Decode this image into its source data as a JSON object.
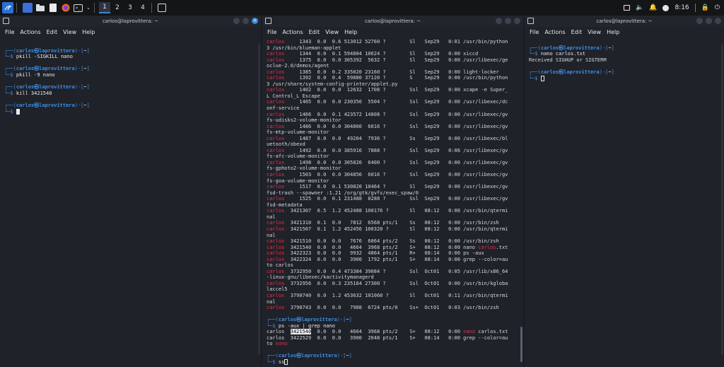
{
  "topbar": {
    "workspaces": [
      "1",
      "2",
      "3",
      "4"
    ],
    "clock": "8:16",
    "icons": [
      "kali-menu-icon",
      "app-icon",
      "folder-icon",
      "text-editor-icon",
      "firefox-icon",
      "terminal-icon",
      "chevron-down-icon",
      "screenshot-icon"
    ],
    "tray": [
      "window-icon",
      "volume-icon",
      "bell-icon",
      "clock-icon",
      "lock-icon",
      "power-icon"
    ]
  },
  "menu": {
    "file": "File",
    "actions": "Actions",
    "edit": "Edit",
    "view": "View",
    "help": "Help"
  },
  "left": {
    "title": "carlos@laprovittera: ~",
    "blocks": [
      {
        "user": "carlos",
        "host": "laprovittera",
        "dir": "~",
        "cmd": "pkill -SIGKILL nano"
      },
      {
        "user": "carlos",
        "host": "laprovittera",
        "dir": "~",
        "cmd": "pkill -9 nano"
      },
      {
        "user": "carlos",
        "host": "laprovittera",
        "dir": "~",
        "cmd": "kill 3421540"
      },
      {
        "user": "carlos",
        "host": "laprovittera",
        "dir": "~",
        "cmd": ""
      }
    ]
  },
  "middle": {
    "title": "carlos@laprovittera: ~",
    "ps_lines": [
      [
        "carlos",
        "     1343  0.0  0.6 513012 52760 ?        Sl   Sep29   0:01 /usr/bin/python"
      ],
      [
        "",
        "3 /usr/bin/blueman-applet"
      ],
      [
        "carlos",
        "     1344  0.0  0.1 594804 10624 ?        Sl   Sep29   0:00 xiccd"
      ],
      [
        "carlos",
        "     1375  0.0  0.0 305392  5632 ?        Sl   Sep29   0:00 /usr/libexec/ge"
      ],
      [
        "",
        "oclue-2.0/demos/agent"
      ],
      [
        "carlos",
        "     1385  0.0  0.2 335020 23160 ?        Sl   Sep29   0:00 light-locker"
      ],
      [
        "carlos",
        "     1392  0.0  0.4  59880 37120 ?        S    Sep29   0:00 /usr/bin/python"
      ],
      [
        "",
        "3 /usr/share/system-config-printer/applet.py"
      ],
      [
        "carlos",
        "     1402  0.0  0.0  12632  1708 ?        Ssl  Sep29   0:00 xcape -e Super_"
      ],
      [
        "",
        "L Control_L Escape"
      ],
      [
        "carlos",
        "     1405  0.0  0.0 230356  5504 ?        Ssl  Sep29   0:00 /usr/libexec/dc"
      ],
      [
        "",
        "onf-service"
      ],
      [
        "carlos",
        "     1466  0.0  0.1 423572 14808 ?        Ssl  Sep29   0:00 /usr/libexec/gv"
      ],
      [
        "",
        "fs-udisks2-volume-monitor"
      ],
      [
        "carlos",
        "     1486  0.0  0.0 304860  6016 ?        Ssl  Sep29   0:00 /usr/libexec/gv"
      ],
      [
        "",
        "fs-mtp-volume-monitor"
      ],
      [
        "carlos",
        "     1487  0.0  0.0  49204  7936 ?        Ss   Sep29   0:00 /usr/libexec/bl"
      ],
      [
        "",
        "uetooth/obexd"
      ],
      [
        "carlos",
        "     1492  0.0  0.0 385916  7888 ?        Ssl  Sep29   0:06 /usr/libexec/gv"
      ],
      [
        "",
        "fs-afc-volume-monitor"
      ],
      [
        "carlos",
        "     1498  0.0  0.0 305820  6400 ?        Ssl  Sep29   0:00 /usr/libexec/gv"
      ],
      [
        "",
        "fs-gphoto2-volume-monitor"
      ],
      [
        "carlos",
        "     1503  0.0  0.0 304856  6016 ?        Ssl  Sep29   0:00 /usr/libexec/gv"
      ],
      [
        "",
        "fs-goa-volume-monitor"
      ],
      [
        "carlos",
        "     1517  0.0  0.1 530820 10464 ?        Sl   Sep29   0:00 /usr/libexec/gv"
      ],
      [
        "",
        "fsd-trash --spawner :1.21 /org/gtk/gvfs/exec_spaw/0"
      ],
      [
        "carlos",
        "     1525  0.0  0.1 231488  8288 ?        Ssl  Sep29   0:00 /usr/libexec/gv"
      ],
      [
        "",
        "fsd-metadata"
      ],
      [
        "carlos",
        "  3421307  0.5  1.2 452488 100176 ?       Sl   08:12   0:00 /usr/bin/qtermi"
      ],
      [
        "",
        "nal"
      ],
      [
        "carlos",
        "  3421310  0.1  0.0   7812  6568 pts/1    Ss   08:12   0:00 /usr/bin/zsh"
      ],
      [
        "carlos",
        "  3421507  0.1  1.2 452456 100320 ?       Sl   08:12   0:00 /usr/bin/qtermi"
      ],
      [
        "",
        "nal"
      ],
      [
        "carlos",
        "  3421510  0.0  0.0   7676  6064 pts/2    Ss   08:12   0:00 /usr/bin/zsh"
      ],
      [
        "carlos",
        "  3421540  0.0  0.0   4664  3968 pts/2    S+   08:12   0:00 nano carlos.txt"
      ],
      [
        "carlos",
        "  3422323  0.0  0.0   9932  4864 pts/1    R+   08:14   0:00 ps -aux"
      ],
      [
        "carlos",
        "  3422324  0.0  0.0   3900  1792 pts/1    S+   08:14   0:00 grep --color=au"
      ],
      [
        "",
        "to carlos"
      ],
      [
        "carlos",
        "  3732950  0.0  0.4 473384 39084 ?        Ssl  Oct01   0:05 /usr/lib/x86_64"
      ],
      [
        "",
        "-linux-gnu/libexec/kactivitymanagerd"
      ],
      [
        "carlos",
        "  3732956  0.0  0.3 235164 27300 ?        Ssl  Oct01   0:00 /usr/bin/kgloba"
      ],
      [
        "",
        "laccel5"
      ],
      [
        "carlos",
        "  3790740  0.0  1.2 453632 101060 ?       Sl   Oct01   0:11 /usr/bin/qtermi"
      ],
      [
        "",
        "nal"
      ],
      [
        "carlos",
        "  3790743  0.0  0.0   7908  6724 pts/0    Ss+  Oct01   0:03 /usr/bin/zsh"
      ]
    ],
    "prompt1": {
      "user": "carlos",
      "host": "laprovittera",
      "dir": "~",
      "cmd": "ps -aux | grep nano"
    },
    "grep_lines": [
      {
        "user": "carlos",
        "pid": "3421540",
        "rest": "  0.0  0.0   4664  3968 pts/2    S+   08:12   0:00 ",
        "hl": "nano",
        "tail": " carlos.txt"
      },
      {
        "user": "carlos",
        "pid": "3422529",
        "rest": "  0.0  0.0   3900  2048 pts/1    S+   08:14   0:00 grep --color=au",
        "hl": "",
        "tail": ""
      }
    ],
    "grep_tail": "to ",
    "grep_tail_red": "nano",
    "prompt2": {
      "user": "carlos",
      "host": "laprovittera",
      "dir": "~",
      "cmd": "ss"
    }
  },
  "right": {
    "title": "carlos@laprovittera: ~",
    "prompt1": {
      "user": "carlos",
      "host": "laprovittera",
      "dir": "~",
      "cmd": "nano carlos.txt"
    },
    "output": "Received SIGHUP or SIGTERM",
    "prompt2": {
      "user": "carlos",
      "host": "laprovittera",
      "dir": "~",
      "cmd": ""
    }
  }
}
